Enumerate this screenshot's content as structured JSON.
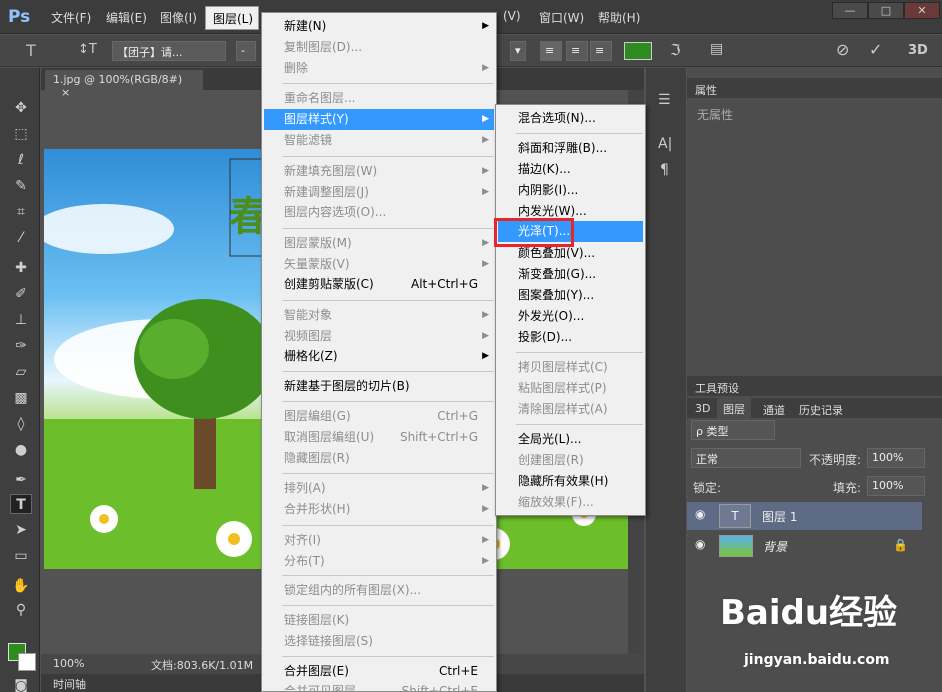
{
  "app": {
    "logo": "Ps"
  },
  "menubar": {
    "items": [
      "文件(F)",
      "编辑(E)",
      "图像(I)",
      "图层(L)",
      "(V)",
      "窗口(W)",
      "帮助(H)"
    ],
    "window_controls": [
      "—",
      "□",
      "✕"
    ]
  },
  "options": {
    "tool_glyph": "T",
    "font_family": "【团子】请...",
    "size_sep": "-",
    "three_d": "3D"
  },
  "document": {
    "tab_title": "1.jpg @ 100%(RGB/8#)",
    "tab_close": "×",
    "zoom": "100%",
    "doc_info": "文档:803.6K/1.01M",
    "timeline": "时间轴",
    "canvas_text": "春"
  },
  "panel": {
    "properties_tab": "属性",
    "properties_empty": "无属性",
    "tool_presets_tab": "工具预设",
    "layer_tabs": [
      "3D",
      "图层",
      "通道",
      "历史记录"
    ],
    "filter_kind": "ρ 类型",
    "blend_mode": "正常",
    "opacity_label": "不透明度:",
    "opacity_value": "100%",
    "lock_label": "锁定:",
    "fill_label": "填充:",
    "fill_value": "100%",
    "layers": [
      {
        "name": "图层 1",
        "thumb": "T"
      },
      {
        "name": "背景"
      }
    ]
  },
  "layer_menu": {
    "items": [
      {
        "label": "新建(N)",
        "submenu": true
      },
      {
        "label": "复制图层(D)...",
        "disabled": true
      },
      {
        "label": "删除",
        "disabled": true,
        "submenu": true
      },
      {
        "label": "重命名图层...",
        "disabled": true
      },
      {
        "label": "图层样式(Y)",
        "highlight": true,
        "submenu": true
      },
      {
        "label": "智能滤镜",
        "disabled": true,
        "submenu": true
      },
      {
        "label": "新建填充图层(W)",
        "disabled": true,
        "submenu": true
      },
      {
        "label": "新建调整图层(J)",
        "disabled": true,
        "submenu": true
      },
      {
        "label": "图层内容选项(O)...",
        "disabled": true
      },
      {
        "label": "图层蒙版(M)",
        "disabled": true,
        "submenu": true
      },
      {
        "label": "矢量蒙版(V)",
        "disabled": true,
        "submenu": true
      },
      {
        "label": "创建剪贴蒙版(C)",
        "shortcut": "Alt+Ctrl+G"
      },
      {
        "label": "智能对象",
        "disabled": true,
        "submenu": true
      },
      {
        "label": "视频图层",
        "disabled": true,
        "submenu": true
      },
      {
        "label": "栅格化(Z)",
        "submenu": true
      },
      {
        "label": "新建基于图层的切片(B)"
      },
      {
        "label": "图层编组(G)",
        "disabled": true,
        "shortcut": "Ctrl+G"
      },
      {
        "label": "取消图层编组(U)",
        "disabled": true,
        "shortcut": "Shift+Ctrl+G"
      },
      {
        "label": "隐藏图层(R)",
        "disabled": true
      },
      {
        "label": "排列(A)",
        "disabled": true,
        "submenu": true
      },
      {
        "label": "合并形状(H)",
        "disabled": true,
        "submenu": true
      },
      {
        "label": "对齐(I)",
        "disabled": true,
        "submenu": true
      },
      {
        "label": "分布(T)",
        "disabled": true,
        "submenu": true
      },
      {
        "label": "锁定组内的所有图层(X)...",
        "disabled": true
      },
      {
        "label": "链接图层(K)",
        "disabled": true
      },
      {
        "label": "选择链接图层(S)",
        "disabled": true
      },
      {
        "label": "合并图层(E)",
        "shortcut": "Ctrl+E"
      },
      {
        "label": "合并可见图层",
        "disabled": true,
        "shortcut": "Shift+Ctrl+E"
      }
    ]
  },
  "style_submenu": {
    "items": [
      {
        "label": "混合选项(N)..."
      },
      {
        "label": "斜面和浮雕(B)..."
      },
      {
        "label": "描边(K)..."
      },
      {
        "label": "内阴影(I)..."
      },
      {
        "label": "内发光(W)..."
      },
      {
        "label": "光泽(T)...",
        "highlight": true
      },
      {
        "label": "颜色叠加(V)..."
      },
      {
        "label": "渐变叠加(G)..."
      },
      {
        "label": "图案叠加(Y)..."
      },
      {
        "label": "外发光(O)..."
      },
      {
        "label": "投影(D)..."
      },
      {
        "label": "拷贝图层样式(C)",
        "disabled": true
      },
      {
        "label": "粘贴图层样式(P)",
        "disabled": true
      },
      {
        "label": "清除图层样式(A)",
        "disabled": true
      },
      {
        "label": "全局光(L)..."
      },
      {
        "label": "创建图层(R)",
        "disabled": true
      },
      {
        "label": "隐藏所有效果(H)"
      },
      {
        "label": "缩放效果(F)...",
        "disabled": true
      }
    ]
  },
  "watermark": {
    "brand": "Baidu经验",
    "url": "jingyan.baidu.com"
  },
  "colors": {
    "highlight": "#3399ff",
    "callout": "#e8262a",
    "foreground": "#2e8b1e"
  }
}
